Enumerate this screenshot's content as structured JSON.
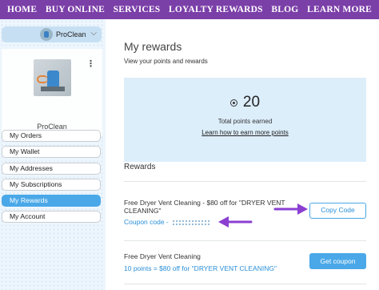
{
  "nav": {
    "items": [
      "HOME",
      "BUY ONLINE",
      "SERVICES",
      "LOYALTY REWARDS",
      "BLOG",
      "LEARN MORE"
    ]
  },
  "sidebar": {
    "user_select": "ProClean",
    "profile_name": "ProClean",
    "menu": [
      {
        "label": "My Orders",
        "active": false
      },
      {
        "label": "My Wallet",
        "active": false
      },
      {
        "label": "My Addresses",
        "active": false
      },
      {
        "label": "My Subscriptions",
        "active": false
      },
      {
        "label": "My Rewards",
        "active": true
      },
      {
        "label": "My Account",
        "active": false
      }
    ]
  },
  "main": {
    "title": "My rewards",
    "subtitle": "View your points and rewards",
    "points": {
      "value": "20",
      "label": "Total points earned",
      "link": "Learn how to earn more points"
    },
    "section_title": "Rewards",
    "rewards": [
      {
        "title": "Free Dryer Vent Cleaning - $80 off for \"DRYER VENT CLEANING\"",
        "link": "Coupon code - ",
        "button": "Copy Code"
      },
      {
        "title": "Free Dryer Vent Cleaning",
        "link": "10 points = $80 off for \"DRYER VENT CLEANING\"",
        "button": "Get coupon"
      }
    ]
  },
  "colors": {
    "nav_bg": "#7b3fa8",
    "accent": "#4aa8e8",
    "points_bg": "#ddeefb",
    "annotation_arrow": "#8a3fd1"
  }
}
